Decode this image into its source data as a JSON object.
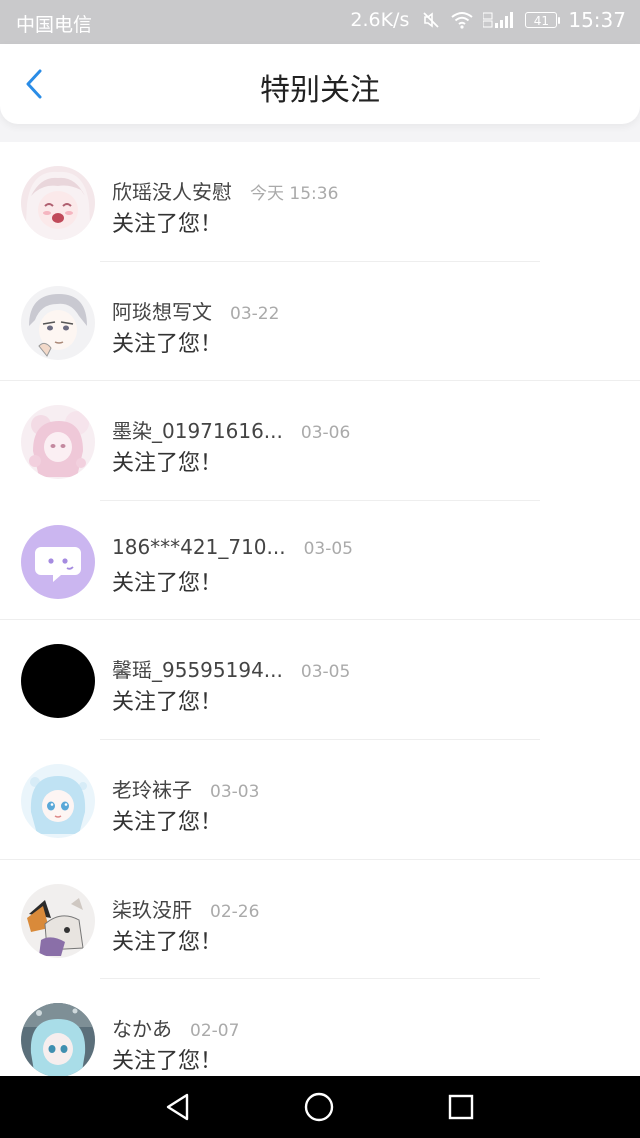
{
  "status_bar": {
    "carrier": "中国电信",
    "network_speed": "2.6K/s",
    "battery": "41",
    "time": "15:37",
    "icons": [
      "mute-icon",
      "wifi-icon",
      "signal-icon",
      "battery-icon"
    ]
  },
  "header": {
    "title": "特别关注",
    "back_icon": "back-arrow-icon",
    "accent_color": "#2a8ce6"
  },
  "notifications": [
    {
      "name": "欣瑶没人安慰",
      "time": "今天 15:36",
      "message": "关注了您！",
      "avatar": "anime-girl-pink"
    },
    {
      "name": "阿琰想写文",
      "time": "03-22",
      "message": "关注了您！",
      "avatar": "anime-boy-sketch"
    },
    {
      "name": "墨染_01971616...",
      "time": "03-06",
      "message": "关注了您！",
      "avatar": "anime-girl-pastel"
    },
    {
      "name": "186***421_710...",
      "time": "03-05",
      "message": "关注了您！",
      "avatar": "chat-bubble-purple"
    },
    {
      "name": "馨瑶_95595194...",
      "time": "03-05",
      "message": "关注了您！",
      "avatar": "solid-black"
    },
    {
      "name": "老玲袜子",
      "time": "03-03",
      "message": "关注了您！",
      "avatar": "anime-girl-blue"
    },
    {
      "name": "柒玖没肝",
      "time": "02-26",
      "message": "关注了您！",
      "avatar": "anime-cat-art"
    },
    {
      "name": "なかあ",
      "time": "02-07",
      "message": "关注了您！",
      "avatar": "anime-girl-teal"
    }
  ],
  "nav_bar": {
    "icons": [
      "back-triangle-icon",
      "home-circle-icon",
      "recents-square-icon"
    ]
  }
}
